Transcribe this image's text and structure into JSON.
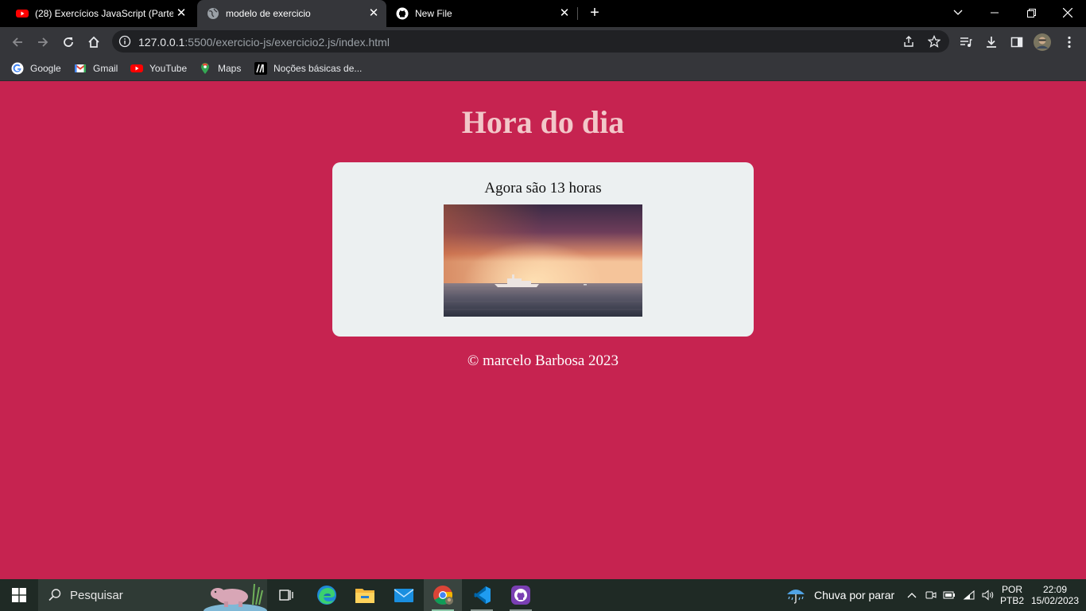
{
  "browser": {
    "tabs": [
      {
        "title": "(28) Exercícios JavaScript (Parte 2",
        "icon": "youtube-icon",
        "active": false
      },
      {
        "title": "modelo de exercicio",
        "icon": "globe-icon",
        "active": true
      },
      {
        "title": "New File",
        "icon": "github-icon",
        "active": false
      }
    ],
    "url_host": "127.0.0.1",
    "url_rest": ":5500/exercicio-js/exercicio2.js/index.html",
    "bookmarks": [
      {
        "label": "Google",
        "icon": "google-icon"
      },
      {
        "label": "Gmail",
        "icon": "gmail-icon"
      },
      {
        "label": "YouTube",
        "icon": "youtube-icon"
      },
      {
        "label": "Maps",
        "icon": "maps-icon"
      },
      {
        "label": "Noções básicas de...",
        "icon": "mdn-icon"
      }
    ]
  },
  "page": {
    "title": "Hora do dia",
    "message": "Agora são 13 horas",
    "footer": "© marcelo Barbosa 2023",
    "background_color": "#c62350",
    "card_color": "#ecf0f1"
  },
  "taskbar": {
    "search_placeholder": "Pesquisar",
    "weather": "Chuva por parar",
    "language_top": "POR",
    "language_bottom": "PTB2",
    "time": "22:09",
    "date": "15/02/2023"
  }
}
